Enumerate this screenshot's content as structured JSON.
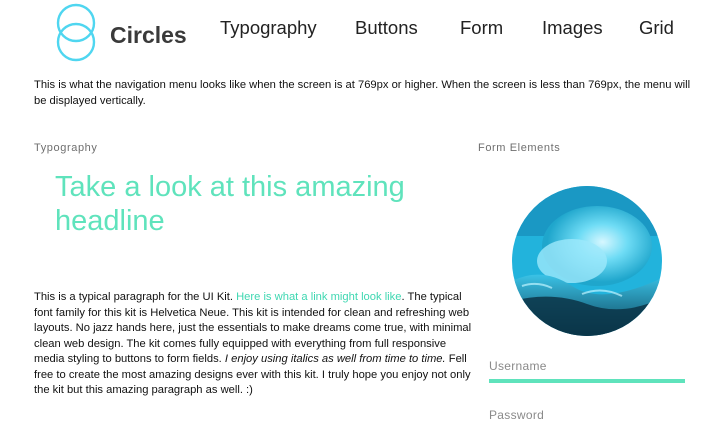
{
  "header": {
    "brand": "Circles",
    "nav": [
      "Typography",
      "Buttons",
      "Form",
      "Images",
      "Grid"
    ]
  },
  "intro_note": "This is what the navigation menu looks like when the screen is at 769px or higher. When the screen is less than 769px, the menu will be displayed vertically.",
  "typography": {
    "section_label": "Typography",
    "headline": "Take a look at this amazing headline",
    "paragraph": {
      "text1": "This is a typical paragraph for the UI Kit. ",
      "link": "Here is what a link might look like",
      "text2": ". The typical font family for this kit is Helvetica Neue. This kit is intended for clean and refreshing web layouts. No jazz hands here, just the essentials to make dreams come true, with minimal clean web design. The kit comes fully equipped with everything from full responsive media styling to buttons to form fields. ",
      "italic": "I enjoy using italics as well from time to time.",
      "text3": " Fell free to create the most amazing designs ever with this kit. I truly hope you enjoy not only the kit but this amazing paragraph as well. :)"
    }
  },
  "form": {
    "section_label": "Form Elements",
    "username_label": "Username",
    "password_label": "Password"
  },
  "colors": {
    "accent": "#5fe3bc",
    "link": "#3ed7b1",
    "logo_ring": "#4fd6f0"
  },
  "icons": [
    "circles-logo"
  ]
}
